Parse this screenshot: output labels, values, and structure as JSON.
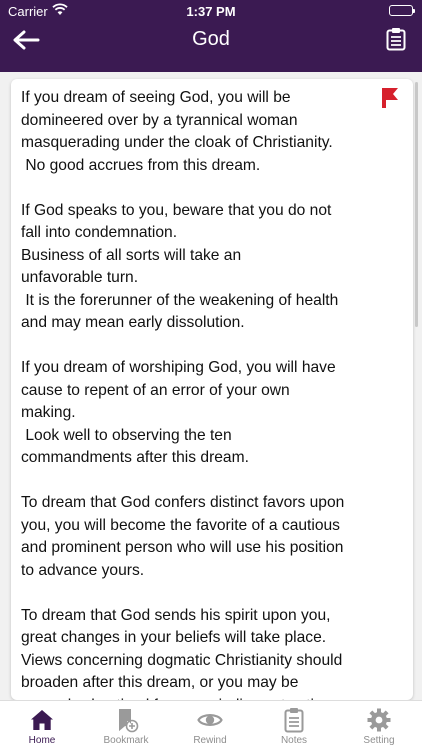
{
  "status_bar": {
    "carrier": "Carrier",
    "time": "1:37 PM"
  },
  "header": {
    "title": "God"
  },
  "icons": {
    "back": "arrow-left-icon",
    "notes": "clipboard-icon",
    "bookmark": "bookmark-flag-icon"
  },
  "colors": {
    "header_bg": "#3b1a52",
    "bookmark_flag": "#d6202c",
    "tab_inactive": "#8e8e8e"
  },
  "article": {
    "text": "If you dream of seeing God, you will be\ndomineered over by a tyrannical woman\nmasquerading under the cloak of Christianity.\n No good accrues from this dream.\n\nIf God speaks to you, beware that you do not\nfall into condemnation.\nBusiness of all sorts will take an\nunfavorable turn.\n It is the forerunner of the weakening of health\nand may mean early dissolution.\n\nIf you dream of worshiping God, you will have\ncause to repent of an error of your own\nmaking.\n Look well to observing the ten\ncommandments after this dream.\n\nTo dream that God confers distinct favors upon\nyou, you will become the favorite of a cautious\nand prominent person who will use his position\nto advance yours.\n\nTo dream that God sends his spirit upon you,\ngreat changes in your beliefs will take place.\nViews concerning dogmatic Christianity should\nbroaden after this dream, or you may be\nseverely chastised for some indiscreet action."
  },
  "tabs": [
    {
      "label": "Home",
      "icon": "home-icon",
      "active": true
    },
    {
      "label": "Bookmark",
      "icon": "bookmark-add-icon",
      "active": false
    },
    {
      "label": "Rewind",
      "icon": "eye-icon",
      "active": false
    },
    {
      "label": "Notes",
      "icon": "notes-icon",
      "active": false
    },
    {
      "label": "Setting",
      "icon": "gear-icon",
      "active": false
    }
  ]
}
